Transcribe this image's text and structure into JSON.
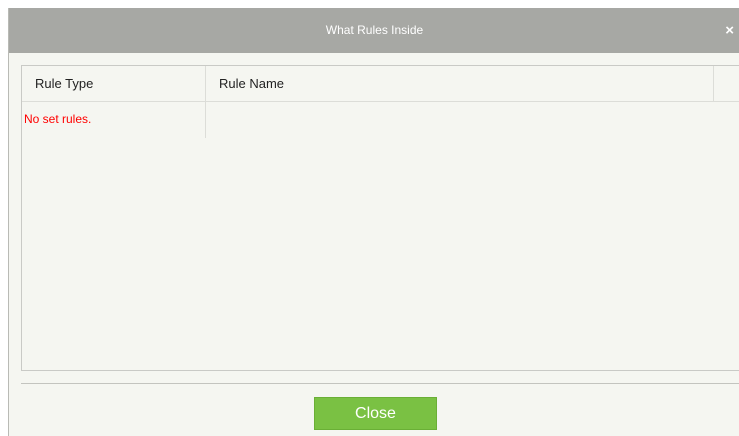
{
  "dialog": {
    "title": "What Rules Inside",
    "close_icon": "×"
  },
  "grid": {
    "columns": [
      "Rule Type",
      "Rule Name"
    ],
    "empty_message": "No set rules."
  },
  "footer": {
    "close_label": "Close"
  },
  "colors": {
    "titlebar": "#a7a8a4",
    "background": "#f5f6f1",
    "close_button": "#7ac143",
    "empty_message": "#ff0000"
  }
}
